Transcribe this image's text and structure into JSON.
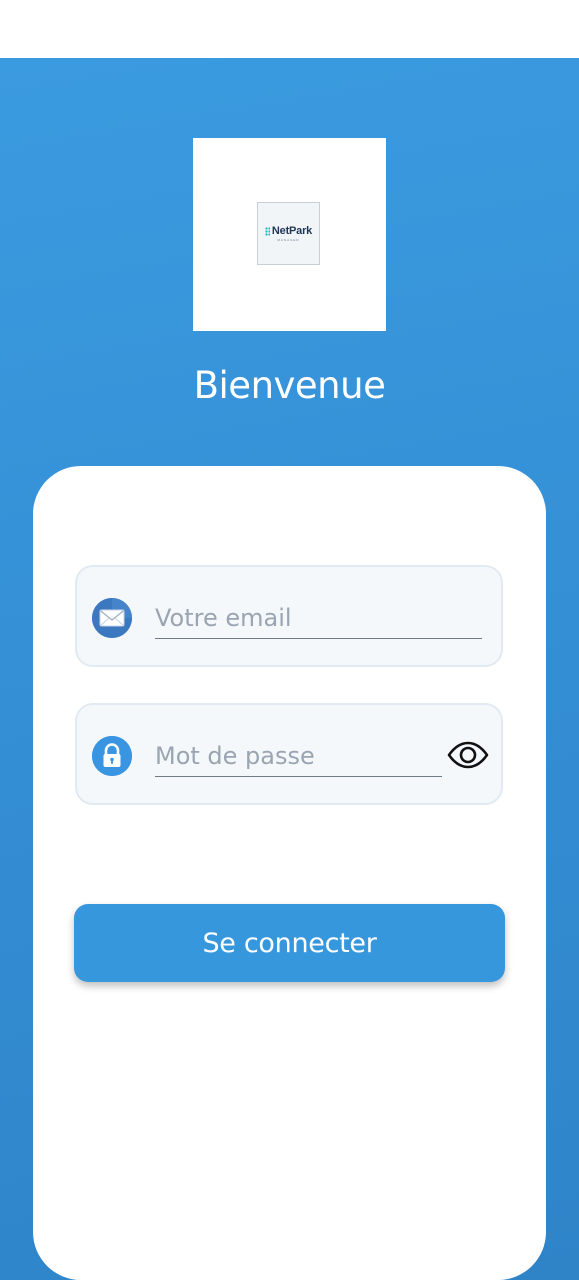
{
  "header": {
    "title": "Bienvenue"
  },
  "logo": {
    "brand_name": "NetPark",
    "brand_tagline": "MANAGER"
  },
  "form": {
    "email": {
      "placeholder": "Votre email",
      "value": "",
      "icon": "envelope-icon"
    },
    "password": {
      "placeholder": "Mot de passe",
      "value": "",
      "icon": "lock-icon",
      "toggle_icon": "eye-icon"
    },
    "submit_label": "Se connecter"
  },
  "colors": {
    "primary": "#3797dd",
    "background_gradient_top": "#3b9be0",
    "background_gradient_bottom": "#2f84c8",
    "card": "#ffffff",
    "field_background": "#f5f8fb"
  }
}
